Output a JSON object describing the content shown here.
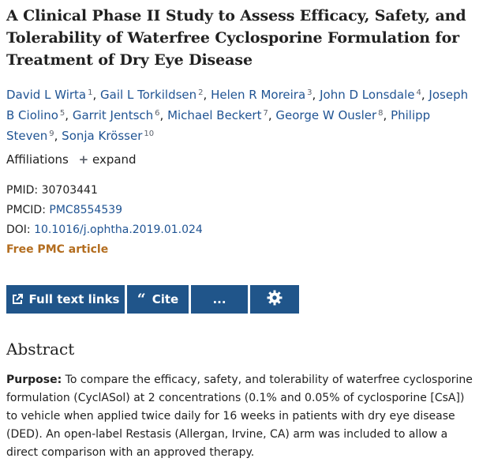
{
  "article": {
    "title": "A Clinical Phase II Study to Assess Efficacy, Safety, and Tolerability of Waterfree Cyclosporine Formulation for Treatment of Dry Eye Disease"
  },
  "authors": [
    {
      "name": "David L Wirta",
      "sup": "1"
    },
    {
      "name": "Gail L Torkildsen",
      "sup": "2"
    },
    {
      "name": "Helen R Moreira",
      "sup": "3"
    },
    {
      "name": "John D Lonsdale",
      "sup": "4"
    },
    {
      "name": "Joseph B Ciolino",
      "sup": "5"
    },
    {
      "name": "Garrit Jentsch",
      "sup": "6"
    },
    {
      "name": "Michael Beckert",
      "sup": "7"
    },
    {
      "name": "George W Ousler",
      "sup": "8"
    },
    {
      "name": "Philipp Steven",
      "sup": "9"
    },
    {
      "name": "Sonja Krösser",
      "sup": "10"
    }
  ],
  "affiliations": {
    "label": "Affiliations",
    "toggle": "expand"
  },
  "ids": {
    "pmid_label": "PMID:",
    "pmid": "30703441",
    "pmcid_label": "PMCID:",
    "pmcid": "PMC8554539",
    "doi_label": "DOI:",
    "doi": "10.1016/j.ophtha.2019.01.024",
    "free_pmc": "Free PMC article"
  },
  "buttons": {
    "full_text": "Full text links",
    "cite": "Cite",
    "more": "...",
    "settings_icon": "gear-icon"
  },
  "abstract": {
    "heading": "Abstract",
    "purpose_label": "Purpose:",
    "purpose_text": "To compare the efficacy, safety, and tolerability of waterfree cyclosporine formulation (CyclASol) at 2 concentrations (0.1% and 0.05% of cyclosporine [CsA]) to vehicle when applied twice daily for 16 weeks in patients with dry eye disease (DED). An open-label Restasis (Allergan, Irvine, CA) arm was included to allow a direct comparison with an approved therapy."
  },
  "colors": {
    "button": "#20558a",
    "link": "#205493",
    "free_pmc": "#b36d1f"
  }
}
